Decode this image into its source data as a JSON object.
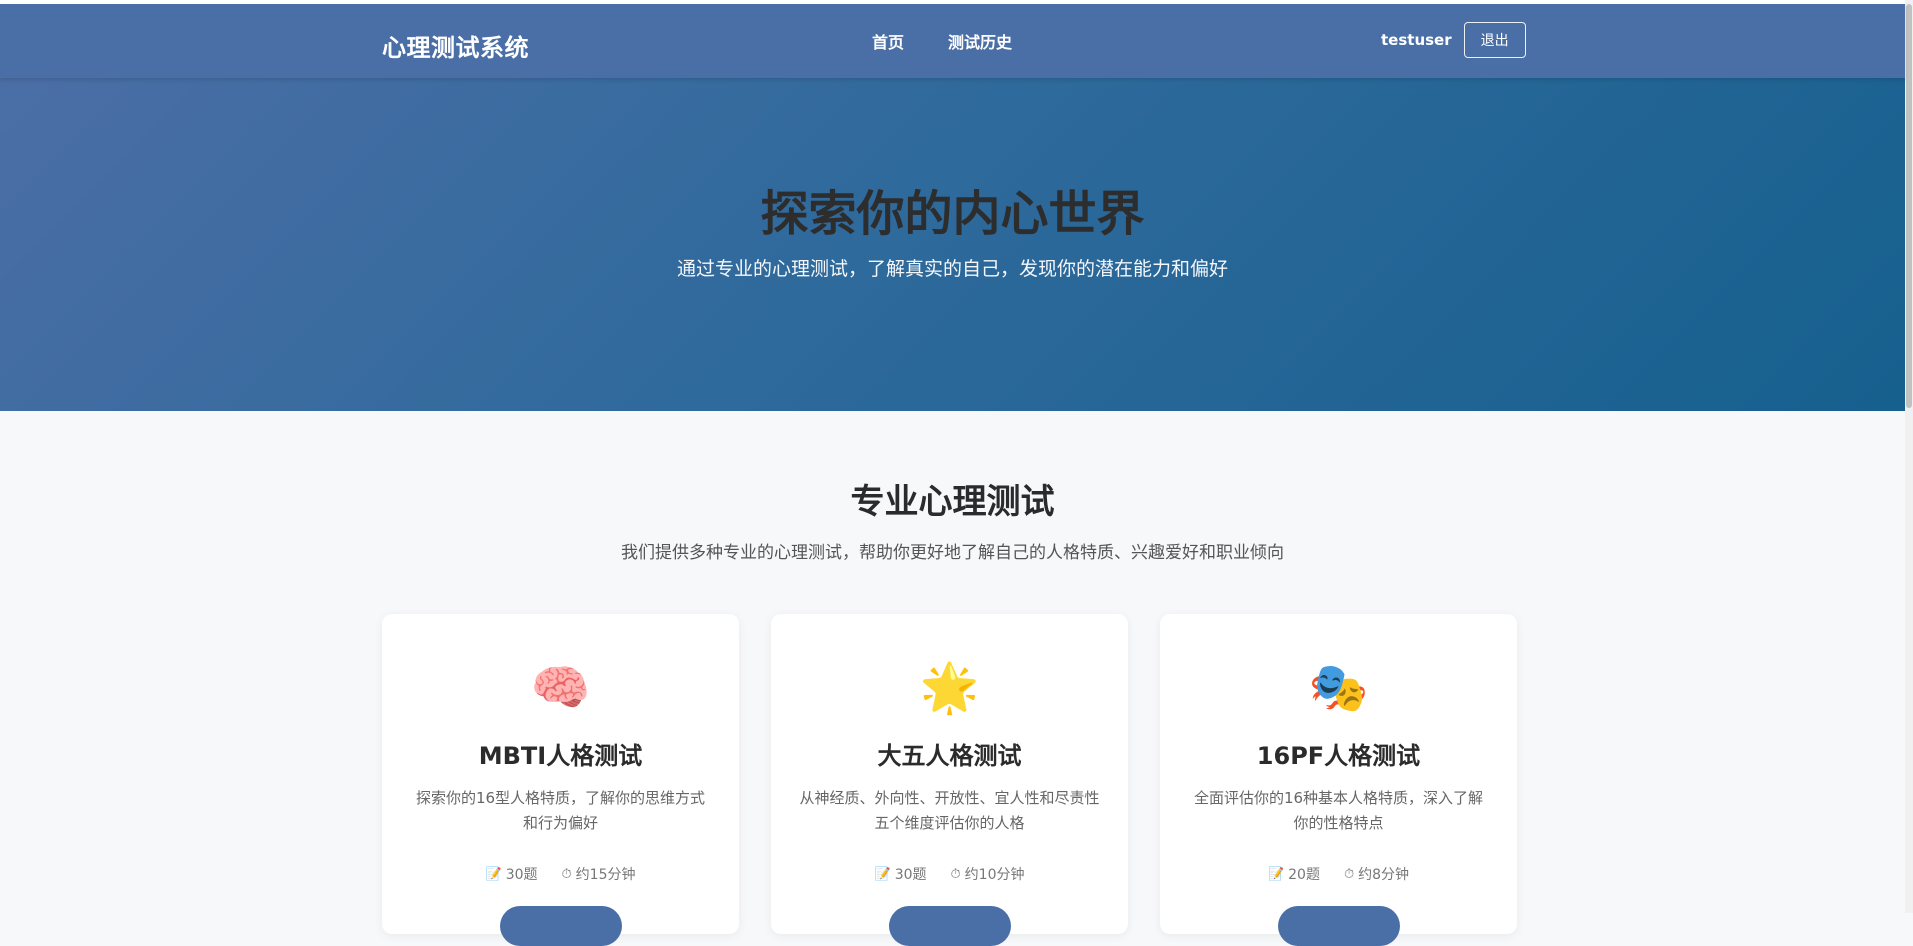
{
  "navbar": {
    "brand": "心理测试系统",
    "links": [
      {
        "label": "首页"
      },
      {
        "label": "测试历史"
      }
    ],
    "username": "testuser",
    "logout_label": "退出"
  },
  "hero": {
    "title": "探索你的内心世界",
    "subtitle": "通过专业的心理测试，了解真实的自己，发现你的潜在能力和偏好"
  },
  "section": {
    "title": "专业心理测试",
    "subtitle": "我们提供多种专业的心理测试，帮助你更好地了解自己的人格特质、兴趣爱好和职业倾向"
  },
  "cards": [
    {
      "icon": "🧠",
      "icon_name": "brain-icon",
      "title": "MBTI人格测试",
      "desc": "探索你的16型人格特质，了解你的思维方式和行为偏好",
      "questions": "30题",
      "duration": "约15分钟"
    },
    {
      "icon": "🌟",
      "icon_name": "star-icon",
      "title": "大五人格测试",
      "desc": "从神经质、外向性、开放性、宜人性和尽责性五个维度评估你的人格",
      "questions": "30题",
      "duration": "约10分钟"
    },
    {
      "icon": "🎭",
      "icon_name": "theater-masks-icon",
      "title": "16PF人格测试",
      "desc": "全面评估你的16种基本人格特质，深入了解你的性格特点",
      "questions": "20题",
      "duration": "约8分钟"
    }
  ],
  "meta_icons": {
    "questions": "📝",
    "duration": "⏱"
  },
  "colors": {
    "primary": "#4a6ea6",
    "hero_end": "#16608e",
    "page_bg": "#f7f8fa"
  }
}
